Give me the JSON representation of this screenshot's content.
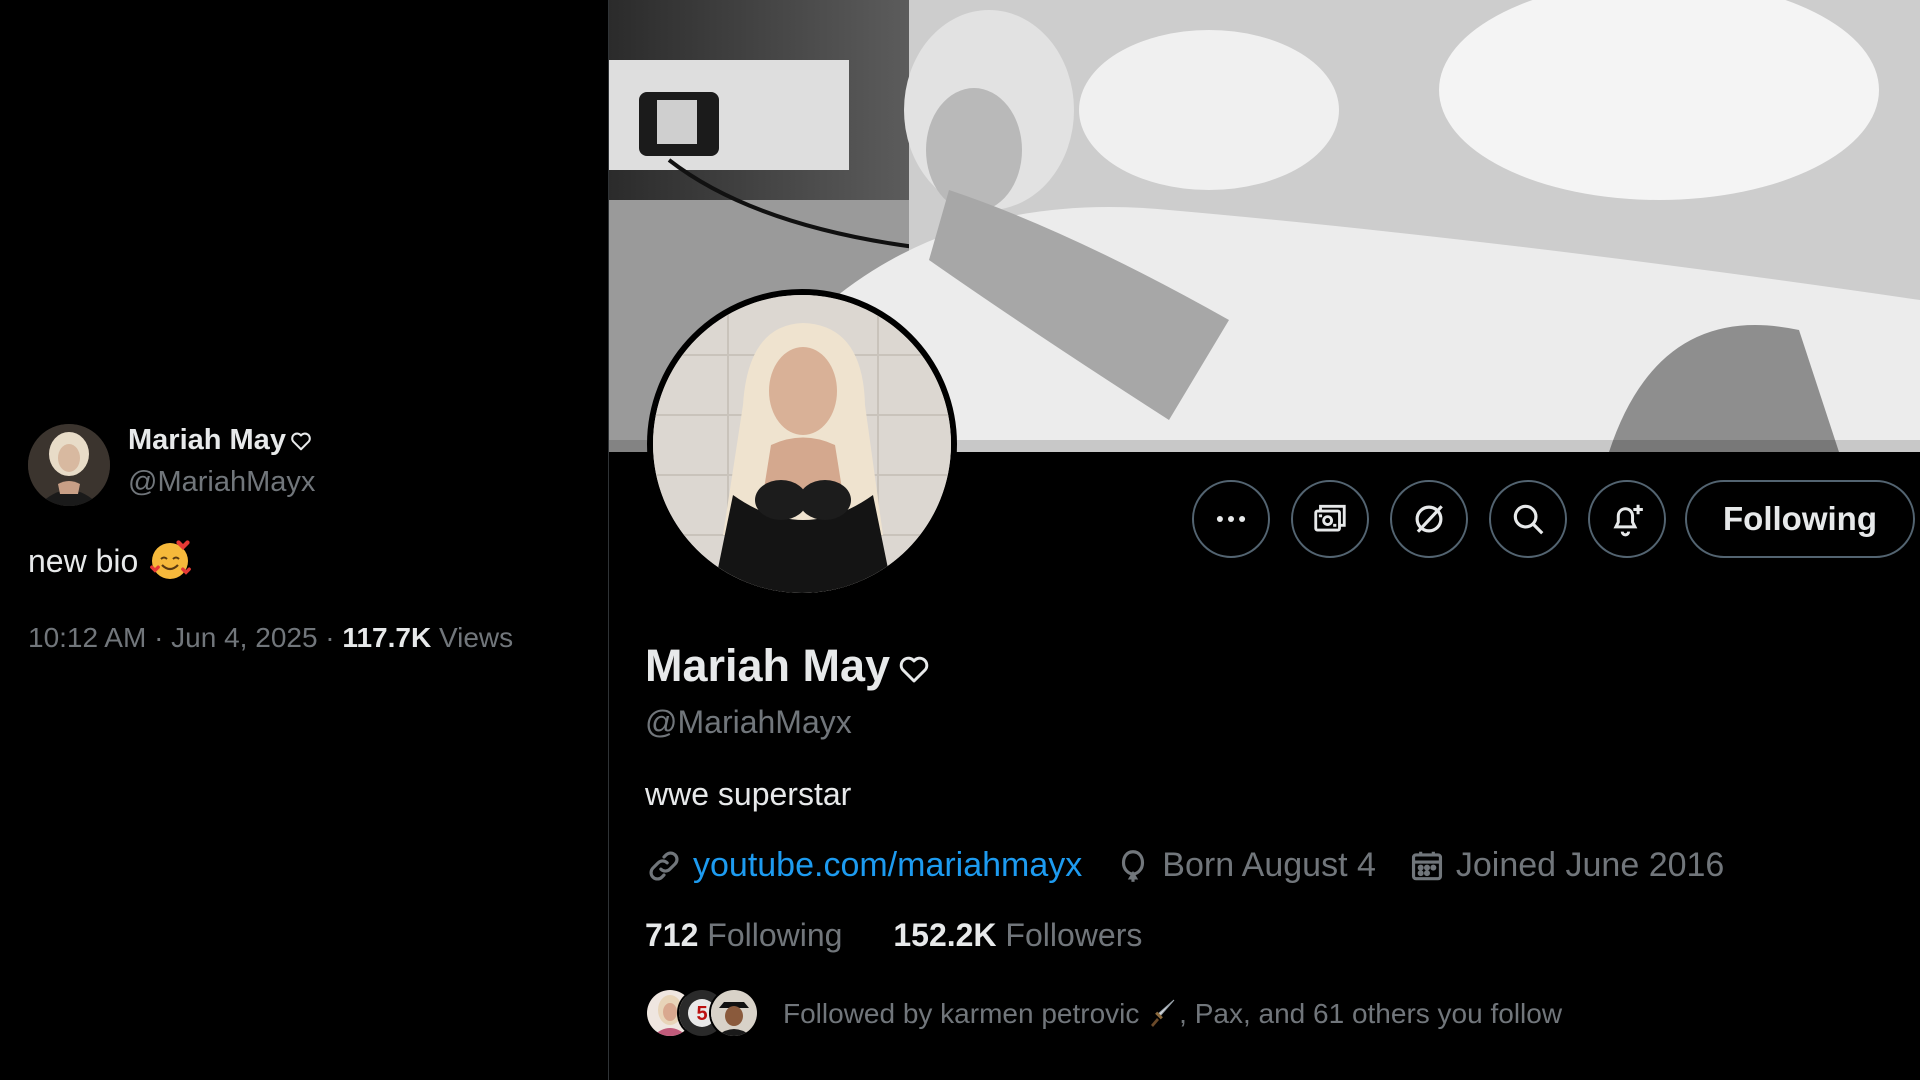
{
  "tweet": {
    "author_name": "Mariah May",
    "author_handle": "@MariahMayx",
    "text": "new bio",
    "emoji": "smiling-face-with-hearts",
    "time": "10:12 AM · Jun 4, 2025 · ",
    "views_count": "117.7K",
    "views_label": " Views"
  },
  "profile": {
    "name": "Mariah May",
    "handle": "@MariahMayx",
    "bio": "wwe superstar",
    "website": "youtube.com/mariahmayx",
    "birthday": "Born August 4",
    "joined": "Joined June 2016",
    "following_count": "712",
    "following_label": " Following",
    "followers_count": "152.2K",
    "followers_label": " Followers",
    "followed_by": "Followed by karmen petrovic",
    "followed_by_rest": ", Pax, and 61 others you follow",
    "follow_button": "Following"
  },
  "icons": [
    "more-icon",
    "subscribe-icon",
    "grok-icon",
    "search-icon",
    "notify-icon",
    "link-icon",
    "balloon-icon",
    "calendar-icon",
    "heart-icon",
    "dagger-icon"
  ],
  "colors": {
    "link": "#1d9bf0",
    "muted": "#71767b",
    "text": "#e7e9ea",
    "border": "#536471"
  }
}
